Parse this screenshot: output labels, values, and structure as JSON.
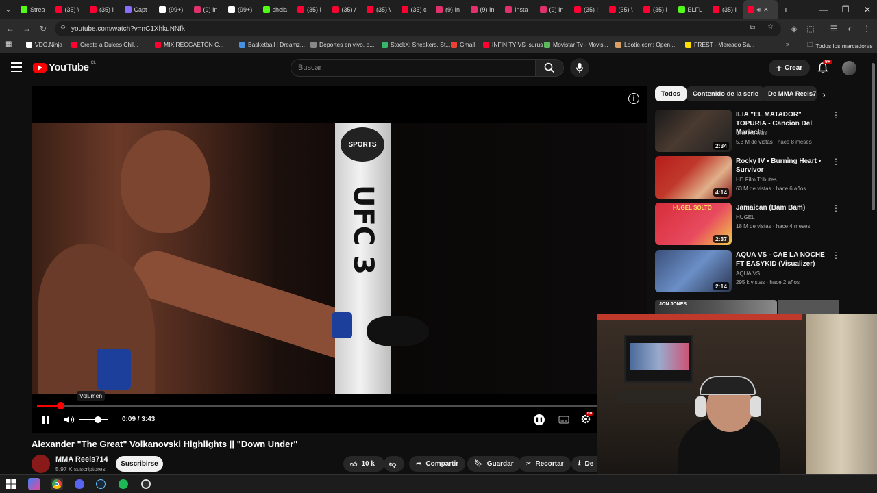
{
  "browser": {
    "tabs": [
      {
        "label": "Strea",
        "color": "#53fc18"
      },
      {
        "label": "(35) \\",
        "color": "#ff0033"
      },
      {
        "label": "(35) I",
        "color": "#ff0033"
      },
      {
        "label": "Capt",
        "color": "#8a6cff"
      },
      {
        "label": "(99+)",
        "color": "#ffffff"
      },
      {
        "label": "(9) In",
        "color": "#e1306c"
      },
      {
        "label": "(99+)",
        "color": "#ffffff"
      },
      {
        "label": "shela",
        "color": "#53fc18"
      },
      {
        "label": "(35) I",
        "color": "#ff0033"
      },
      {
        "label": "(35) /",
        "color": "#ff0033"
      },
      {
        "label": "(35) \\",
        "color": "#ff0033"
      },
      {
        "label": "(35) c",
        "color": "#ff0033"
      },
      {
        "label": "(9) In",
        "color": "#e1306c"
      },
      {
        "label": "(9) In",
        "color": "#e1306c"
      },
      {
        "label": "Insta",
        "color": "#e1306c"
      },
      {
        "label": "(9) In",
        "color": "#e1306c"
      },
      {
        "label": "(35) !",
        "color": "#ff0033"
      },
      {
        "label": "(35) \\",
        "color": "#ff0033"
      },
      {
        "label": "(35) I",
        "color": "#ff0033"
      },
      {
        "label": "ELFL",
        "color": "#53fc18"
      },
      {
        "label": "(35) I",
        "color": "#ff0033"
      }
    ],
    "url": "youtube.com/watch?v=nC1XhkuNNfk",
    "bookmarks": [
      {
        "label": "VDO.Ninja",
        "color": "#ffffff"
      },
      {
        "label": "Create a Dulces Chil...",
        "color": "#ff0033"
      },
      {
        "label": "MIX REGGAETÓN C...",
        "color": "#ff0033"
      },
      {
        "label": "Basketball | Dreamz...",
        "color": "#4a90e2"
      },
      {
        "label": "Deportes en vivo, p...",
        "color": "#888888"
      },
      {
        "label": "StockX: Sneakers, St...",
        "color": "#38b56a"
      },
      {
        "label": "Gmail",
        "color": "#ea4335"
      },
      {
        "label": "INFINITY VS Isurus",
        "color": "#ff0033"
      },
      {
        "label": "Movistar Tv - Movis...",
        "color": "#5cb85c"
      },
      {
        "label": "Lootie.com: Open...",
        "color": "#d9a066"
      },
      {
        "label": "FREST - Mercado Sa...",
        "color": "#ffdd00"
      }
    ],
    "all_bookmarks": "Todos los marcadores"
  },
  "youtube": {
    "logo": "YouTube",
    "country": "CL",
    "search_placeholder": "Buscar",
    "create_label": "Crear",
    "notif_badge": "9+"
  },
  "video": {
    "time": "0:09 / 3:43",
    "progress_fraction": 0.041,
    "volume_tooltip": "Volumen",
    "title": "Alexander \"The Great\" Volkanovski Highlights || \"Down Under\"",
    "channel": "MMA Reels714",
    "subscribers": "5.97 K suscriptores",
    "subscribe_label": "Suscribirse",
    "likes": "10 k",
    "share_label": "Compartir",
    "save_label": "Guardar",
    "clip_label": "Recortar",
    "download_label": "De"
  },
  "sidebar": {
    "chips": [
      "Todos",
      "Contenido de la serie",
      "De MMA Reels7"
    ],
    "recommendations": [
      {
        "title": "ILIA \"EL MATADOR\" TOPURIA - Cancion Del Mariachi",
        "channel": "One Moment",
        "meta": "5.3 M de vistas · hace 8 meses",
        "duration": "2:34"
      },
      {
        "title": "Rocky IV • Burning Heart • Survivor",
        "channel": "HD Film Tributes",
        "meta": "63 M de vistas · hace 6 años",
        "duration": "4:14"
      },
      {
        "title": "Jamaican (Bam Bam)",
        "channel": "HUGEL",
        "meta": "18 M de vistas · hace 4 meses",
        "duration": "2:37"
      },
      {
        "title": "AQUA VS - CAE LA NOCHE FT EASYKID (Visualizer)",
        "channel": "AQUA VS",
        "meta": "295 k vistas · hace 2 años",
        "duration": "2:14"
      }
    ]
  },
  "overlay": {
    "thumb_text_1": "HUGEL SOLTO",
    "thumb_text_2": "JON JONES"
  },
  "colors": {
    "accent": "#ff0000",
    "background": "#0f0f0f"
  }
}
